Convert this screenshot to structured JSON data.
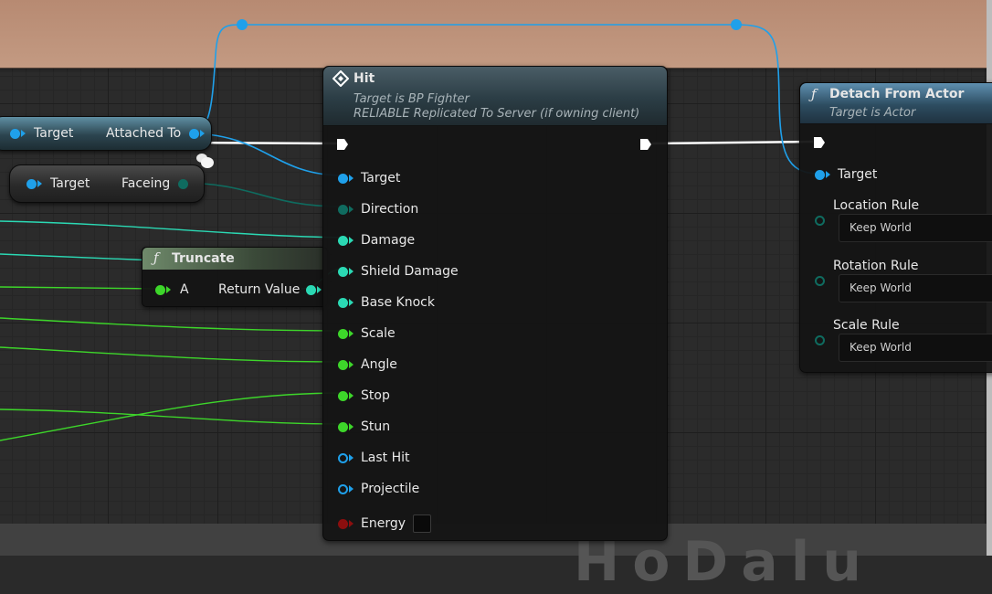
{
  "comment_box": {
    "color": "#c39a82"
  },
  "watermark": {
    "text": "HoDalu"
  },
  "var_nodes": {
    "attached": {
      "target_label": "Target",
      "output_label": "Attached To"
    },
    "facing": {
      "target_label": "Target",
      "output_label": "Faceing"
    }
  },
  "truncate_node": {
    "title": "Truncate",
    "icon": "function-icon",
    "input_label": "A",
    "output_label": "Return Value"
  },
  "hit_node": {
    "title": "Hit",
    "icon": "event-diamond-icon",
    "subtitle_1": "Target is BP Fighter",
    "subtitle_2": "RELIABLE Replicated To Server (if owning client)",
    "pins": [
      {
        "label": "Target",
        "color": "#1fa0ea",
        "kind": "object"
      },
      {
        "label": "Direction",
        "color": "#0f6b5f",
        "kind": "vector"
      },
      {
        "label": "Damage",
        "color": "#2bd9b4",
        "kind": "float"
      },
      {
        "label": "Shield Damage",
        "color": "#2bd9b4",
        "kind": "float"
      },
      {
        "label": "Base Knock",
        "color": "#2bd9b4",
        "kind": "float"
      },
      {
        "label": "Scale",
        "color": "#3dd62a",
        "kind": "float"
      },
      {
        "label": "Angle",
        "color": "#3dd62a",
        "kind": "float"
      },
      {
        "label": "Stop",
        "color": "#3dd62a",
        "kind": "float"
      },
      {
        "label": "Stun",
        "color": "#3dd62a",
        "kind": "float"
      },
      {
        "label": "Last Hit",
        "color": "#1fa0ea",
        "kind": "object-unconnected"
      },
      {
        "label": "Projectile",
        "color": "#1fa0ea",
        "kind": "object-unconnected"
      },
      {
        "label": "Energy",
        "color": "#8b0e0e",
        "kind": "byte"
      }
    ]
  },
  "detach_node": {
    "title": "Detach From Actor",
    "icon": "function-icon",
    "subtitle": "Target is Actor",
    "target_label": "Target",
    "rules": [
      {
        "label": "Location Rule",
        "value": "Keep World"
      },
      {
        "label": "Rotation Rule",
        "value": "Keep World"
      },
      {
        "label": "Scale Rule",
        "value": "Keep World"
      }
    ]
  },
  "colors": {
    "object_pin": "#1fa0ea",
    "vector_pin": "#0f6b5f",
    "float_pin": "#2bd9b4",
    "int_pin": "#3dd62a",
    "byte_pin": "#8b0e0e",
    "exec_pin": "#ffffff",
    "detach_rule_pin": "#0f6b5f"
  }
}
